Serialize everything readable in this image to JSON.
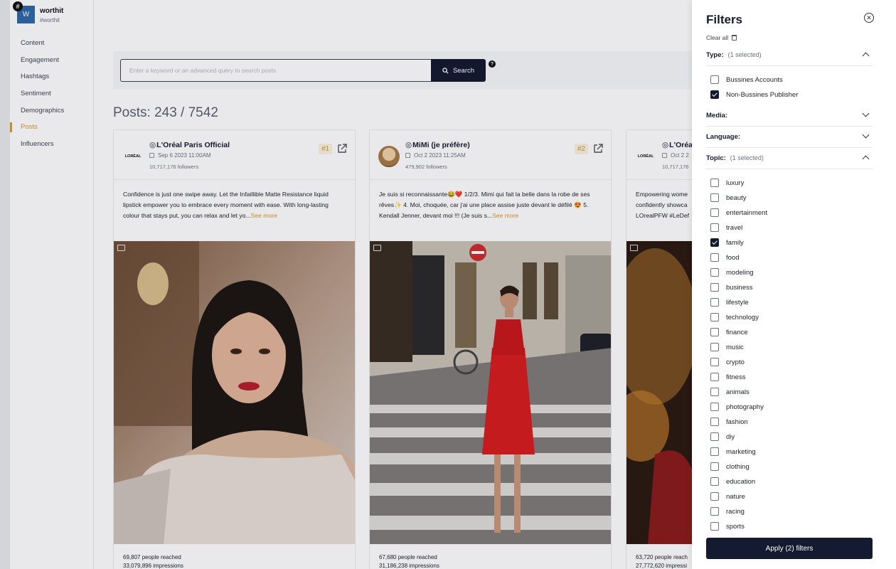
{
  "brand": {
    "name": "worthit",
    "handle": "#worthit",
    "logo_letter": "W",
    "badge": "#"
  },
  "nav": {
    "items": [
      {
        "label": "Content",
        "active": false
      },
      {
        "label": "Engagement",
        "active": false
      },
      {
        "label": "Hashtags",
        "active": false
      },
      {
        "label": "Sentiment",
        "active": false
      },
      {
        "label": "Demographics",
        "active": false
      },
      {
        "label": "Posts",
        "active": true
      },
      {
        "label": "Influencers",
        "active": false
      }
    ],
    "active_color": "#d9982b"
  },
  "search": {
    "placeholder": "Enter a keyword or an advanced query to search posts",
    "value": "",
    "button_label": "Search",
    "button_icon": "magnifier-icon",
    "help_icon": "question-icon",
    "help_glyph": "?"
  },
  "posts_count": "Posts: 243 / 7542",
  "posts": [
    {
      "author": "L'Oréal Paris Official",
      "ig_glyph": "◎",
      "avatar_text": "LORÉAL",
      "date": "Sep 6 2023 11:00AM",
      "followers": "10,717,176 followers",
      "rank": "#1",
      "caption": "Confidence is just one swipe away. Let the Infaillible Matte Resistance liquid lipstick empower you to embrace every moment with ease. With long-lasting colour that stays put, you can relax and let yo...",
      "see_more": "See more",
      "reached": "69,807 people reached",
      "impressions": "33,079,896 impressions"
    },
    {
      "author": "MiMi (je préfère)",
      "ig_glyph": "◎",
      "avatar_text": "",
      "date": "Oct 2 2023 11:25AM",
      "followers": "479,902 followers",
      "rank": "#2",
      "caption": "Je suis si reconnaissante😂❤️ 1/2/3. Mimi qui fait la belle dans la robe de ses rêves✨ 4. Moi, choquée, car j'ai une place assise juste devant le défilé 😍 5. Kendall Jenner, devant moi !!! (Je suis s...",
      "see_more": "See more",
      "reached": "67,680 people reached",
      "impressions": "31,186,238 impressions"
    },
    {
      "author": "L'Oréa",
      "ig_glyph": "◎",
      "avatar_text": "LORÉAL",
      "date": "Oct 2 2",
      "followers": "10,717,176",
      "rank": "",
      "caption": "Empowering wome confidently showca LOrealPFW #LeDef",
      "see_more": "",
      "reached": "63,720 people reach",
      "impressions": "27,772,620 impressi"
    }
  ],
  "filters": {
    "title": "Filters",
    "clear_all": "Clear all",
    "close_glyph": "✕",
    "type": {
      "label": "Type:",
      "selected": "(1 selected)",
      "expanded": true,
      "options": [
        {
          "label": "Bussines Accounts",
          "checked": false
        },
        {
          "label": "Non-Bussines Publisher",
          "checked": true
        }
      ]
    },
    "media": {
      "label": "Media:",
      "expanded": false
    },
    "language": {
      "label": "Language:",
      "expanded": false
    },
    "topic": {
      "label": "Topic:",
      "selected": "(1 selected)",
      "expanded": true,
      "options": [
        {
          "label": "luxury",
          "checked": false
        },
        {
          "label": "beauty",
          "checked": false
        },
        {
          "label": "entertainment",
          "checked": false
        },
        {
          "label": "travel",
          "checked": false
        },
        {
          "label": "family",
          "checked": true
        },
        {
          "label": "food",
          "checked": false
        },
        {
          "label": "modeling",
          "checked": false
        },
        {
          "label": "business",
          "checked": false
        },
        {
          "label": "lifestyle",
          "checked": false
        },
        {
          "label": "technology",
          "checked": false
        },
        {
          "label": "finance",
          "checked": false
        },
        {
          "label": "music",
          "checked": false
        },
        {
          "label": "crypto",
          "checked": false
        },
        {
          "label": "fitness",
          "checked": false
        },
        {
          "label": "animals",
          "checked": false
        },
        {
          "label": "photography",
          "checked": false
        },
        {
          "label": "fashion",
          "checked": false
        },
        {
          "label": "diy",
          "checked": false
        },
        {
          "label": "marketing",
          "checked": false
        },
        {
          "label": "clothing",
          "checked": false
        },
        {
          "label": "education",
          "checked": false
        },
        {
          "label": "nature",
          "checked": false
        },
        {
          "label": "racing",
          "checked": false
        },
        {
          "label": "sports",
          "checked": false
        }
      ]
    },
    "apply_label": "Apply  (2)  filters"
  },
  "colors": {
    "primary": "#141a30",
    "accent": "#d9982b",
    "rank_bg": "#fbf2dc"
  }
}
